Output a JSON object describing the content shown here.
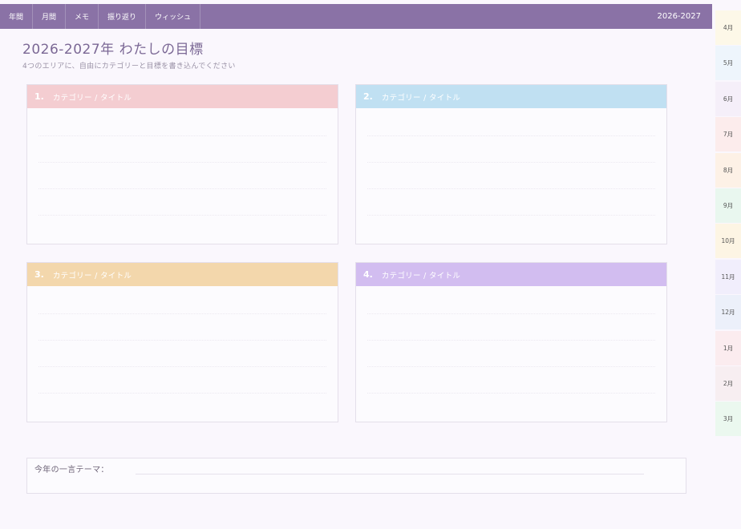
{
  "nav": {
    "tabs": [
      "年間",
      "月間",
      "メモ",
      "振り返り",
      "ウィッシュ"
    ],
    "year_label": "2026-2027"
  },
  "header": {
    "title": "2026-2027年 わたしの目標",
    "subtitle": "4つのエリアに、自由にカテゴリーと目標を書き込んでください"
  },
  "quadrants": [
    {
      "number": "1.",
      "label": "カテゴリー / タイトル",
      "color": "#f4cdd1"
    },
    {
      "number": "2.",
      "label": "カテゴリー / タイトル",
      "color": "#c0e0f2"
    },
    {
      "number": "3.",
      "label": "カテゴリー / タイトル",
      "color": "#f3d7ac"
    },
    {
      "number": "4.",
      "label": "カテゴリー / タイトル",
      "color": "#d2bdf0"
    }
  ],
  "theme": {
    "label": "今年の一言テーマ："
  },
  "months": [
    {
      "label": "4月",
      "color": "#fdf8e8"
    },
    {
      "label": "5月",
      "color": "#eef5fc"
    },
    {
      "label": "6月",
      "color": "#f5eff9"
    },
    {
      "label": "7月",
      "color": "#fcecec"
    },
    {
      "label": "8月",
      "color": "#fdf1e6"
    },
    {
      "label": "9月",
      "color": "#e9f7ef"
    },
    {
      "label": "10月",
      "color": "#fdf5e4"
    },
    {
      "label": "11月",
      "color": "#f1eefc"
    },
    {
      "label": "12月",
      "color": "#ecf0fa"
    },
    {
      "label": "1月",
      "color": "#fbecef"
    },
    {
      "label": "2月",
      "color": "#f7eef1"
    },
    {
      "label": "3月",
      "color": "#ebf8ef"
    }
  ]
}
